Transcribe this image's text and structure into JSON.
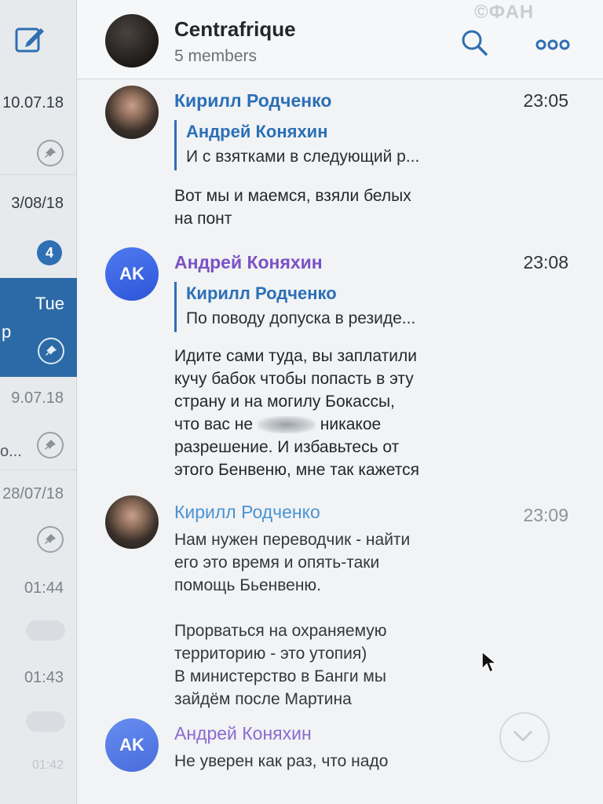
{
  "watermark": "©ФАН",
  "sidebar": {
    "entries": [
      {
        "date": "10.07.18"
      },
      {
        "date": "3/08/18",
        "badge": "4"
      },
      {
        "date": "Tue",
        "snippet": "p",
        "active": true
      },
      {
        "date": "9.07.18",
        "snippet": "o..."
      },
      {
        "date": "28/07/18"
      },
      {
        "date": "01:44"
      },
      {
        "date": "01:43"
      },
      {
        "date": "01:42"
      }
    ]
  },
  "chat": {
    "title": "Centrafrique",
    "subtitle": "5 members"
  },
  "messages": [
    {
      "sender": "Кирилл Родченко",
      "time": "23:05",
      "reply_to_name": "Андрей Коняхин",
      "reply_to_text": "И с взятками в следующий р...",
      "text": "Вот мы и маемся, взяли белых\nна понт"
    },
    {
      "sender": "Андрей Коняхин",
      "initials": "AK",
      "time": "23:08",
      "reply_to_name": "Кирилл Родченко",
      "reply_to_text": "По поводу допуска в резиде...",
      "text_part1": "Идите сами туда, вы заплатили\nкучу бабок чтобы попасть в эту\nстрану и на могилу Бокассы,\nчто вас не",
      "text_part2": "никакое\nразрешение. И избавьтесь от\nэтого Бенвеню, мне так кажется"
    },
    {
      "sender": "Кирилл Родченко",
      "time": "23:09",
      "text": "Нам нужен переводчик - найти\nего это время и опять-таки\nпомощь Бьенвеню.\n\nПрорваться на охраняемую\nтерриторию - это утопия)\nВ министерство в Банги мы\nзайдём после Мартина"
    },
    {
      "sender": "Андрей Коняхин",
      "initials": "AK",
      "text": "Не уверен как раз, что надо"
    }
  ],
  "colors": {
    "accent": "#2f6fb3",
    "active_row": "#2b6aa6",
    "sender_blue": "#2b6fb7",
    "sender_purple": "#7b52c5"
  }
}
